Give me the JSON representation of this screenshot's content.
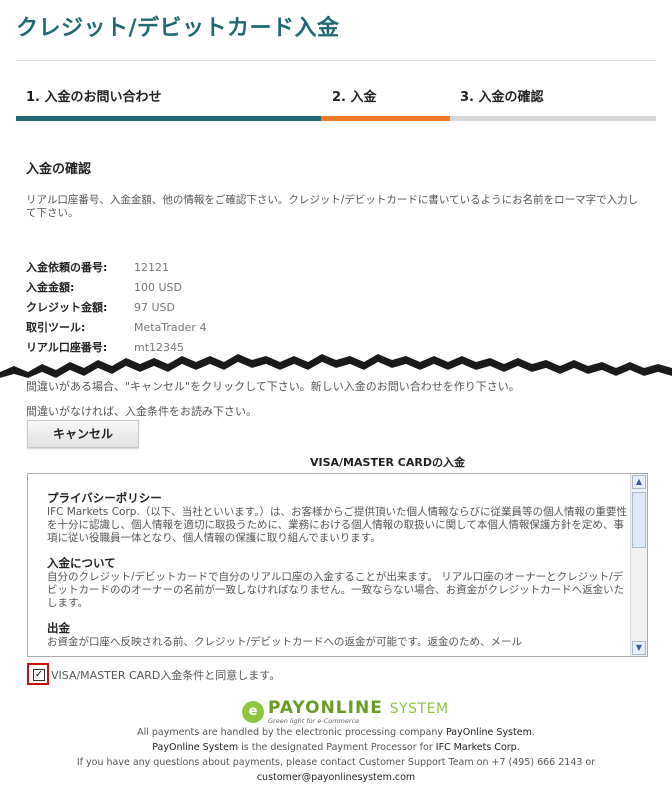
{
  "page": {
    "title": "クレジット/デビットカード入金"
  },
  "steps": [
    {
      "label": "1. 入金のお問い合わせ"
    },
    {
      "label": "2. 入金"
    },
    {
      "label": "3. 入金の確認"
    }
  ],
  "confirm": {
    "heading": "入金の確認",
    "intro": "リアル口座番号、入金金額、他の情報をご確認下さい。クレジット/デビットカードに書いているようにお名前をローマ字で入力して下さい。",
    "rows": [
      {
        "label": "入金依頼の番号:",
        "value": "12121"
      },
      {
        "label": "入金金額:",
        "value": "100 USD"
      },
      {
        "label": "クレジット金額:",
        "value": "97 USD"
      },
      {
        "label": "取引ツール:",
        "value": "MetaTrader 4"
      },
      {
        "label": "リアル口座番号:",
        "value": "mt12345"
      }
    ]
  },
  "notes": {
    "mistake": "間違いがある場合、\"キャンセル\"をクリックして下さい。新しい入金のお問い合わせを作り下さい。",
    "no_mistake": "間違いがなければ、入金条件をお読み下さい。"
  },
  "buttons": {
    "cancel": "キャンセル"
  },
  "terms": {
    "title": "VISA/MASTER CARDの入金",
    "sections": [
      {
        "heading": "プライバシーポリシー",
        "body": "IFC Markets Corp.（以下、当社といいます。）は、お客様からご提供頂いた個人情報ならびに従業員等の個人情報の重要性を十分に認識し、個人情報を適切に取扱うために、業務における個人情報の取扱いに関して本個人情報保護方針を定め、事項に従い役職員一体となり、個人情報の保護に取り組んでまいります。"
      },
      {
        "heading": "入金について",
        "body": "自分のクレジット/デビットカードで自分のリアル口座の入金することが出来ます。 リアル口座のオーナーとクレジット/デビットカードののオーナーの名前が一致しなければなりません。一致ならない場合、お資金がクレジットカードへ返金いたします。"
      },
      {
        "heading": "出金",
        "body": "お資金が口座へ反映される前、クレジット/デビットカードへの返金が可能です。返金のため、メール"
      }
    ]
  },
  "agree": {
    "label": "VISA/MASTER CARD入金条件と同意します。",
    "checked": true
  },
  "branding": {
    "logo_name": "PAYONLINE",
    "logo_suffix": "SYSTEM",
    "tagline": "Green light for e-Commerce"
  },
  "footer": {
    "line1a": "All payments are handled by the electronic processing company ",
    "line1b": "PayOnline System",
    "line1c": ".",
    "line2a": "PayOnline System",
    "line2b": " is the designated Payment Processor for ",
    "line2c": "IFC Markets Corp",
    "line2d": ".",
    "line3": "If you have any questions about payments, please contact Customer Support Team on +7 (495) 666 2143 or",
    "email": "customer@payonlinesystem.com"
  }
}
